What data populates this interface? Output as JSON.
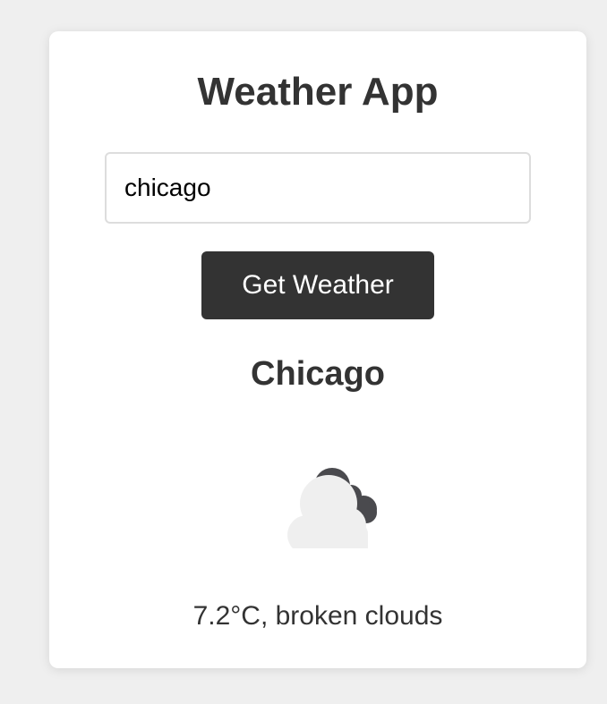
{
  "app": {
    "title": "Weather App"
  },
  "search": {
    "value": "chicago"
  },
  "button": {
    "label": "Get Weather"
  },
  "result": {
    "city": "Chicago",
    "icon": "broken-clouds-icon",
    "description": "7.2°C, broken clouds"
  },
  "colors": {
    "page_background": "#efefef",
    "card_background": "#ffffff",
    "button_background": "#333333",
    "button_text": "#ffffff",
    "text": "#333333"
  }
}
